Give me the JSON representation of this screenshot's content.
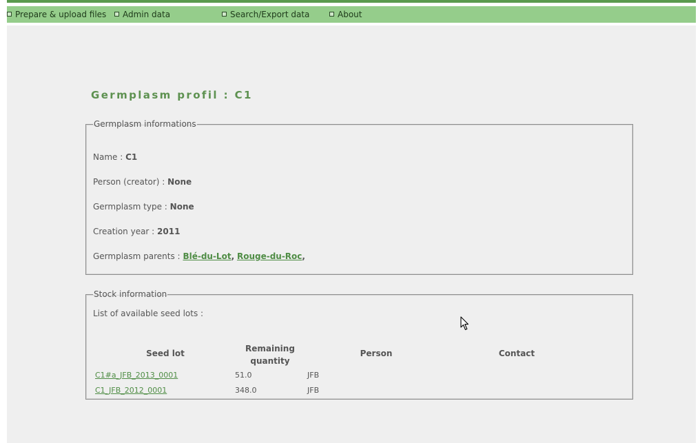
{
  "menu": {
    "items": [
      {
        "label": "Prepare & upload files"
      },
      {
        "label": "Admin data"
      },
      {
        "label": "Search/Export data"
      },
      {
        "label": "About"
      }
    ]
  },
  "page": {
    "title": "Germplasm profil : C1"
  },
  "germplasm_info": {
    "legend": "Germplasm informations",
    "name_label": "Name :",
    "name_value": "C1",
    "person_label": "Person (creator) :",
    "person_value": "None",
    "type_label": "Germplasm type :",
    "type_value": "None",
    "year_label": "Creation year :",
    "year_value": "2011",
    "parents_label": "Germplasm parents :",
    "parents": [
      "Blé-du-Lot",
      "Rouge-du-Roc"
    ],
    "separator": ","
  },
  "stock_info": {
    "legend": "Stock information",
    "list_label": "List of available seed lots :",
    "headers": {
      "seed_lot": "Seed lot",
      "remaining_line1": "Remaining",
      "remaining_line2": "quantity",
      "person": "Person",
      "contact": "Contact"
    },
    "rows": [
      {
        "seed_lot": "C1#a_JFB_2013_0001",
        "quantity": "51.0",
        "person": "JFB",
        "contact": ""
      },
      {
        "seed_lot": "C1_JFB_2012_0001",
        "quantity": "348.0",
        "person": "JFB",
        "contact": ""
      }
    ]
  },
  "colors": {
    "accent_green": "#5d9150",
    "menubar_green": "#95cd8b",
    "link_green": "#4e8c44",
    "panel_bg": "#efefef"
  }
}
